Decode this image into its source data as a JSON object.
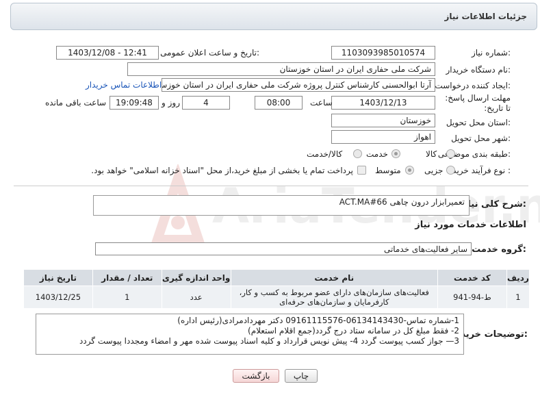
{
  "header": {
    "title": "جزئیات اطلاعات نیاز"
  },
  "fields": {
    "need_number": {
      "label": "شماره نیاز:",
      "value": "1103093985010574"
    },
    "announce": {
      "label": "تاریخ و ساعت اعلان عمومی:",
      "value": "1403/12/08 - 12:41"
    },
    "buyer_org": {
      "label": "نام دستگاه خریدار:",
      "value": "شرکت ملی حفاری ایران در استان خوزستان"
    },
    "creator": {
      "label": "ایجاد کننده درخواست:",
      "value": "آرتا ابوالحسنی کارشناس کنترل پروژه شرکت ملی حفاری ایران در استان خوزستان",
      "contact_link": "اطلاعات تماس خریدار"
    },
    "deadline": {
      "label": "مهلت ارسال پاسخ: تا تاریخ:",
      "date": "1403/12/13",
      "time_label": "ساعت",
      "time": "08:00",
      "days": "4",
      "days_label": "روز و",
      "remaining": "19:09:48",
      "remaining_label": "ساعت باقی مانده"
    },
    "province": {
      "label": "استان محل تحویل:",
      "value": "خوزستان"
    },
    "city": {
      "label": "شهر محل تحویل:",
      "value": "اهواز"
    },
    "category": {
      "label": "طبقه بندی موضوعی:",
      "options": [
        "کالا",
        "خدمت",
        "کالا/خدمت"
      ],
      "selected": "خدمت"
    },
    "process": {
      "label": "نوع فرآیند خرید :",
      "options": [
        "جزیی",
        "متوسط"
      ],
      "selected": "متوسط",
      "payment_note": "پرداخت تمام یا بخشی از مبلغ خرید،از محل \"اسناد خزانه اسلامی\" خواهد بود."
    }
  },
  "summary": {
    "label": "شرح کلی نیاز:",
    "value": "تعمیرابزار درون چاهی ACT.MA#66"
  },
  "services_section": {
    "title": "اطلاعات خدمات مورد نیاز"
  },
  "service_group": {
    "label": "گروه خدمت:",
    "value": "سایر فعالیت‌های خدماتی"
  },
  "table": {
    "headers": [
      "ردیف",
      "کد خدمت",
      "نام خدمت",
      "واحد اندازه گیری",
      "تعداد / مقدار",
      "تاریخ نیاز"
    ],
    "rows": [
      [
        "1",
        "ط-94-941",
        "فعالیت‌های سازمان‌های دارای عضو مربوط به کسب و کار، کارفرمایان و سازمان‌های حرفه‌ای",
        "عدد",
        "1",
        "1403/12/25"
      ]
    ]
  },
  "buyer_notes": {
    "label": "توضیحات خریدار:",
    "lines": [
      "1-شماره تماس-06134143430-09161115576 دکتر مهردادمرادی(رئیس اداره)",
      "2- فقط مبلغ کل در سامانه ستاد درج گردد(جمع اقلام استعلام)",
      "3— جواز کسب  پیوست گردد 4- پیش نویس قرارداد  و کلیه اسناد پیوست شده مهر و امضاء ومجددا پیوست  گردد"
    ]
  },
  "buttons": {
    "print": "چاپ",
    "back": "بازگشت"
  },
  "watermark": {
    "text": "AriaTender.net"
  },
  "colors": {
    "link": "#1a55b8",
    "header_bg": "#dde3ea",
    "table_header": "#d8dde3"
  }
}
